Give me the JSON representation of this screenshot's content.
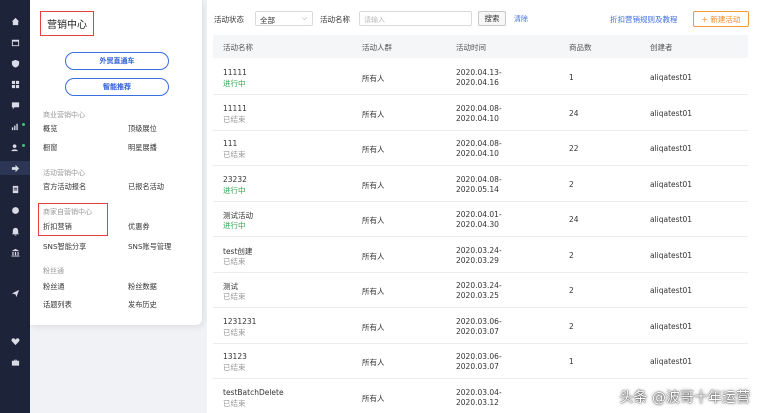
{
  "sidebar_icons": [
    "home-icon",
    "window-icon",
    "shield-icon",
    "grid-icon",
    "message-icon",
    "chart-icon",
    "users-icon",
    "share-icon",
    "document-icon",
    "circle-icon",
    "bell-icon",
    "bank-icon",
    "send-icon",
    "heart-icon",
    "briefcase-icon"
  ],
  "panel": {
    "title": "营销中心",
    "buttons": [
      "外贸直通车",
      "智能推荐"
    ],
    "sections": [
      {
        "header": "商业营销中心",
        "links": [
          "概览",
          "顶级展位",
          "橱窗",
          "明星展播"
        ]
      },
      {
        "header": "活动营销中心",
        "links": [
          "官方活动报名",
          "已报名活动"
        ]
      },
      {
        "header": "商家自营销中心",
        "links": [
          "折扣营销",
          "优惠券",
          "SNS智能分享",
          "SNS账号管理"
        ]
      },
      {
        "header": "粉丝通",
        "links": [
          "粉丝通",
          "粉丝数据",
          "话题列表",
          "发布历史"
        ]
      }
    ]
  },
  "filter": {
    "status_label": "活动状态",
    "status_value": "全部",
    "name_label": "活动名称",
    "name_placeholder": "请输入",
    "search_label": "搜索",
    "clear_label": "清除",
    "help_link": "折扣营销规则及教程",
    "new_label": "+ 新建活动"
  },
  "table": {
    "columns": [
      "活动名称",
      "活动人群",
      "活动时间",
      "商品数",
      "创建者"
    ],
    "rows": [
      {
        "name": "11111",
        "status": "进行中",
        "active": true,
        "crowd": "所有人",
        "start": "2020.04.13-",
        "end": "2020.04.16",
        "count": "1",
        "creator": "aliqatest01"
      },
      {
        "name": "11111",
        "status": "已结束",
        "active": false,
        "crowd": "所有人",
        "start": "2020.04.08-",
        "end": "2020.04.10",
        "count": "24",
        "creator": "aliqatest01"
      },
      {
        "name": "111",
        "status": "已结束",
        "active": false,
        "crowd": "所有人",
        "start": "2020.04.08-",
        "end": "2020.04.10",
        "count": "22",
        "creator": "aliqatest01"
      },
      {
        "name": "23232",
        "status": "进行中",
        "active": true,
        "crowd": "所有人",
        "start": "2020.04.08-",
        "end": "2020.05.14",
        "count": "2",
        "creator": "aliqatest01"
      },
      {
        "name": "测试活动",
        "status": "进行中",
        "active": true,
        "crowd": "所有人",
        "start": "2020.04.01-",
        "end": "2020.04.30",
        "count": "24",
        "creator": "aliqatest01"
      },
      {
        "name": "test创建",
        "status": "已结束",
        "active": false,
        "crowd": "所有人",
        "start": "2020.03.24-",
        "end": "2020.03.29",
        "count": "2",
        "creator": "aliqatest01"
      },
      {
        "name": "测试",
        "status": "已结束",
        "active": false,
        "crowd": "所有人",
        "start": "2020.03.24-",
        "end": "2020.03.25",
        "count": "2",
        "creator": "aliqatest01"
      },
      {
        "name": "1231231",
        "status": "已结束",
        "active": false,
        "crowd": "所有人",
        "start": "2020.03.06-",
        "end": "2020.03.07",
        "count": "2",
        "creator": "aliqatest01"
      },
      {
        "name": "13123",
        "status": "已结束",
        "active": false,
        "crowd": "所有人",
        "start": "2020.03.06-",
        "end": "2020.03.07",
        "count": "1",
        "creator": "aliqatest01"
      },
      {
        "name": "testBatchDelete",
        "status": "已结束",
        "active": false,
        "crowd": "所有人",
        "start": "2020.03.04-",
        "end": "2020.03.12",
        "count": "",
        "creator": ""
      }
    ]
  },
  "watermark": "头条 @波哥十年运营",
  "colors": {
    "accent": "#3b6ee0",
    "active_status": "#2ea24a",
    "highlight": "#e53e3e",
    "new_button": "#f08c2c"
  }
}
